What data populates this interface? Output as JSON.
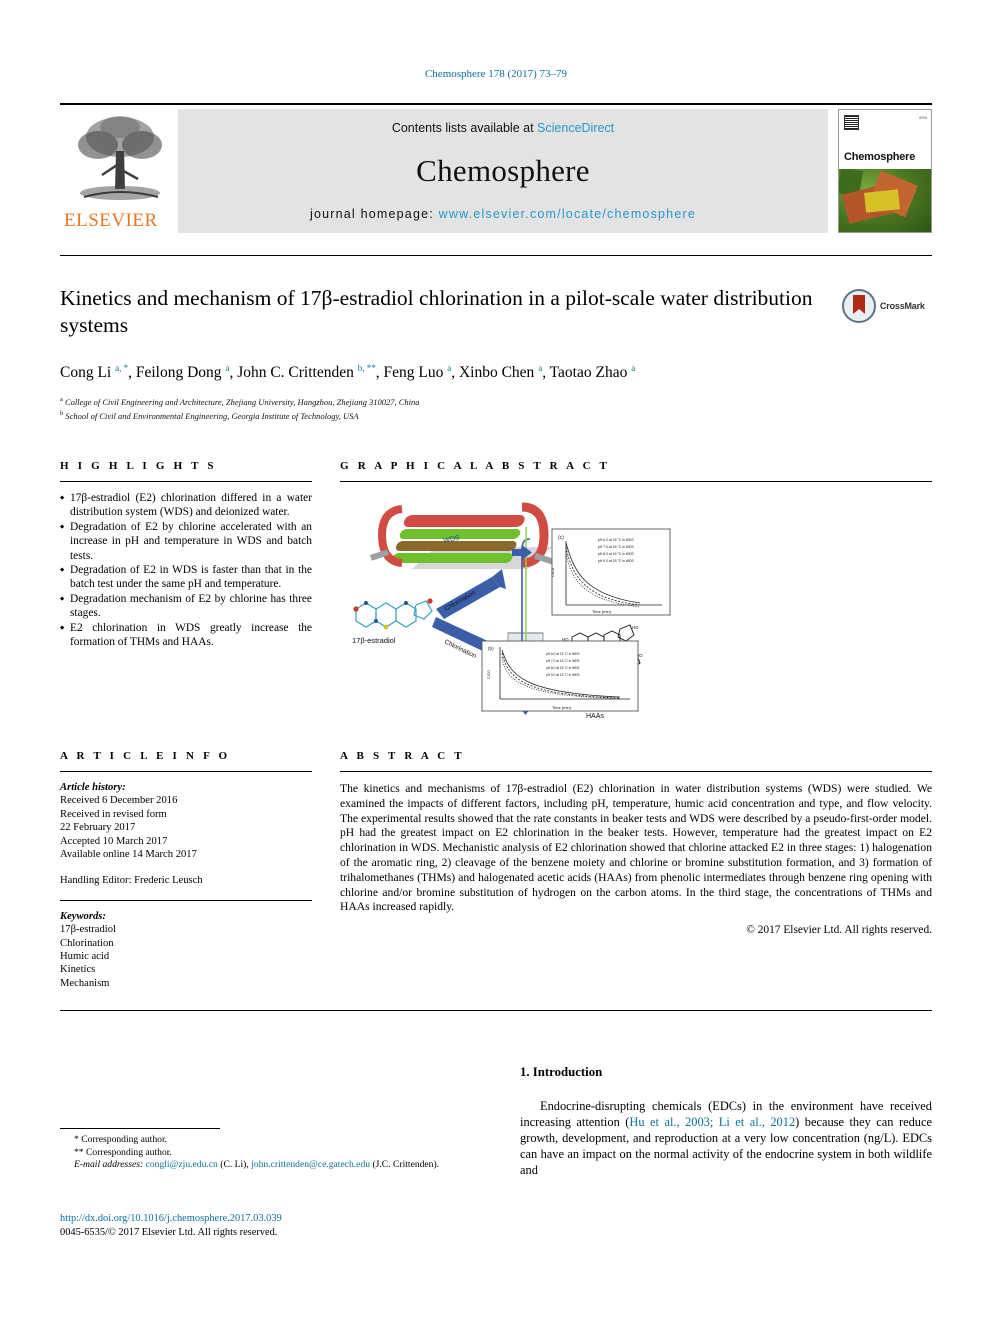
{
  "running_head": "Chemosphere 178 (2017) 73–79",
  "masthead": {
    "contents_prefix": "Contents lists available at",
    "sciencedirect": "ScienceDirect",
    "journal_name": "Chemosphere",
    "homepage_prefix": "journal homepage:",
    "homepage_url": "www.elsevier.com/locate/chemosphere",
    "publisher": "ELSEVIER",
    "cover_brand": "Chemosphere",
    "accent_link_color": "#2596d1",
    "masthead_bg": "#e3e3e3",
    "elsevier_orange": "#E87722"
  },
  "article": {
    "title": "Kinetics and mechanism of 17β-estradiol chlorination in a pilot-scale water distribution systems",
    "crossmark_label": "CrossMark",
    "authors_html": "Cong Li <sup>a, <span class=\"star\">*</span></sup>, Feilong Dong <sup>a</sup>, John C. Crittenden <sup>b, <span class=\"star\">**</span></sup>, Feng Luo <sup>a</sup>, Xinbo Chen <sup>a</sup>, Taotao Zhao <sup>a</sup>",
    "affiliations": [
      {
        "marker": "a",
        "text": "College of Civil Engineering and Architecture, Zhejiang University, Hangzhou, Zhejiang 310027, China"
      },
      {
        "marker": "b",
        "text": "School of Civil and Environmental Engineering, Georgia Institute of Technology, USA"
      }
    ]
  },
  "highlights": {
    "heading": "H I G H L I G H T S",
    "items": [
      "17β-estradiol (E2) chlorination differed in a water distribution system (WDS) and deionized water.",
      "Degradation of E2 by chlorine accelerated with an increase in pH and temperature in WDS and batch tests.",
      "Degradation of E2 in WDS is faster than that in the batch test under the same pH and temperature.",
      "Degradation mechanism of E2 by chlorine has three stages.",
      "E2 chlorination in WDS greatly increase the formation of THMs and HAAs."
    ]
  },
  "graphical_abstract": {
    "heading": "G R A P H I C A L   A B S T R A C T",
    "labels": {
      "molecule": "17β-estradiol",
      "arrow_top": "Chlorination",
      "arrow_bottom": "Chlorination",
      "thms": "THMs",
      "haas": "HAAs",
      "wds_pipe": "WDS",
      "chart_axis_y": "C/C0",
      "chart_axis_x": "Time (min)"
    },
    "legend_items": [
      "pH 6.0 at 15 °C in WDS",
      "pH 7.0 at 15 °C in WDS",
      "pH 8.0 at 15 °C in WDS",
      "pH 9.0 at 15 °C in WDS"
    ]
  },
  "article_info": {
    "heading": "A R T I C L E   I N F O",
    "history_label": "Article history:",
    "history": [
      "Received 6 December 2016",
      "Received in revised form",
      "22 February 2017",
      "Accepted 10 March 2017",
      "Available online 14 March 2017"
    ],
    "handling_editor": "Handling Editor: Frederic Leusch",
    "keywords_label": "Keywords:",
    "keywords": [
      "17β-estradiol",
      "Chlorination",
      "Humic acid",
      "Kinetics",
      "Mechanism"
    ]
  },
  "abstract": {
    "heading": "A B S T R A C T",
    "body": "The kinetics and mechanisms of 17β-estradiol (E2) chlorination in water distribution systems (WDS) were studied. We examined the impacts of different factors, including pH, temperature, humic acid concentration and type, and flow velocity. The experimental results showed that the rate constants in beaker tests and WDS were described by a pseudo-first-order model. pH had the greatest impact on E2 chlorination in the beaker tests. However, temperature had the greatest impact on E2 chlorination in WDS. Mechanistic analysis of E2 chlorination showed that chlorine attacked E2 in three stages: 1) halogenation of the aromatic ring, 2) cleavage of the benzene moiety and chlorine or bromine substitution formation, and 3) formation of trihalomethanes (THMs) and halogenated acetic acids (HAAs) from phenolic intermediates through benzene ring opening with chlorine and/or bromine substitution of hydrogen on the carbon atoms. In the third stage, the concentrations of THMs and HAAs increased rapidly.",
    "copyright": "© 2017 Elsevier Ltd. All rights reserved."
  },
  "introduction": {
    "heading": "1. Introduction",
    "paragraph_pre": "Endocrine-disrupting chemicals (EDCs) in the environment have received increasing attention (",
    "citation": "Hu et al., 2003; Li et al., 2012",
    "paragraph_post": ") because they can reduce growth, development, and reproduction at a very low concentration (ng/L). EDCs can have an impact on the normal activity of the endocrine system in both wildlife and"
  },
  "footer": {
    "corresponding_1": "Corresponding author.",
    "corresponding_2": "Corresponding author.",
    "email_label": "E-mail addresses:",
    "email_1": "congli@zju.edu.cn",
    "email_1_who": "(C. Li),",
    "email_2": "john.crittenden@ce.gatech.edu",
    "email_2_who": "(J.C. Crittenden).",
    "doi": "http://dx.doi.org/10.1016/j.chemosphere.2017.03.039",
    "issn_line": "0045-6535/© 2017 Elsevier Ltd. All rights reserved."
  }
}
